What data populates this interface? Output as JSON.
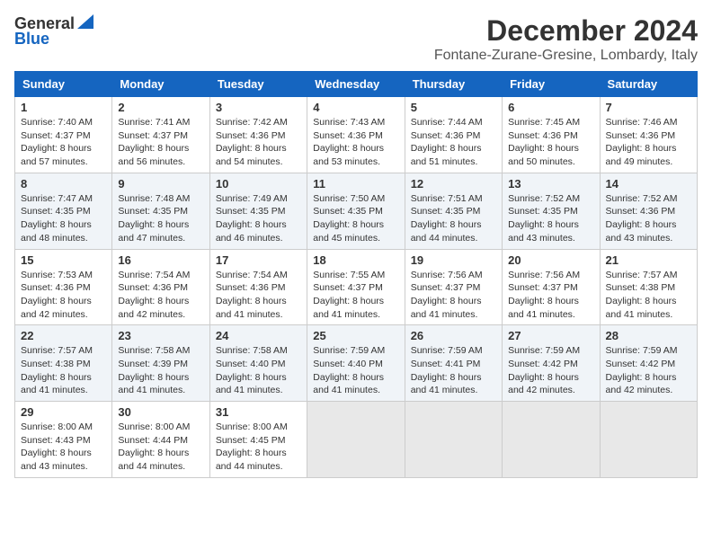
{
  "header": {
    "logo_general": "General",
    "logo_blue": "Blue",
    "month_title": "December 2024",
    "location": "Fontane-Zurane-Gresine, Lombardy, Italy"
  },
  "days_of_week": [
    "Sunday",
    "Monday",
    "Tuesday",
    "Wednesday",
    "Thursday",
    "Friday",
    "Saturday"
  ],
  "weeks": [
    [
      {
        "day": "1",
        "sunrise": "Sunrise: 7:40 AM",
        "sunset": "Sunset: 4:37 PM",
        "daylight": "Daylight: 8 hours and 57 minutes."
      },
      {
        "day": "2",
        "sunrise": "Sunrise: 7:41 AM",
        "sunset": "Sunset: 4:37 PM",
        "daylight": "Daylight: 8 hours and 56 minutes."
      },
      {
        "day": "3",
        "sunrise": "Sunrise: 7:42 AM",
        "sunset": "Sunset: 4:36 PM",
        "daylight": "Daylight: 8 hours and 54 minutes."
      },
      {
        "day": "4",
        "sunrise": "Sunrise: 7:43 AM",
        "sunset": "Sunset: 4:36 PM",
        "daylight": "Daylight: 8 hours and 53 minutes."
      },
      {
        "day": "5",
        "sunrise": "Sunrise: 7:44 AM",
        "sunset": "Sunset: 4:36 PM",
        "daylight": "Daylight: 8 hours and 51 minutes."
      },
      {
        "day": "6",
        "sunrise": "Sunrise: 7:45 AM",
        "sunset": "Sunset: 4:36 PM",
        "daylight": "Daylight: 8 hours and 50 minutes."
      },
      {
        "day": "7",
        "sunrise": "Sunrise: 7:46 AM",
        "sunset": "Sunset: 4:36 PM",
        "daylight": "Daylight: 8 hours and 49 minutes."
      }
    ],
    [
      {
        "day": "8",
        "sunrise": "Sunrise: 7:47 AM",
        "sunset": "Sunset: 4:35 PM",
        "daylight": "Daylight: 8 hours and 48 minutes."
      },
      {
        "day": "9",
        "sunrise": "Sunrise: 7:48 AM",
        "sunset": "Sunset: 4:35 PM",
        "daylight": "Daylight: 8 hours and 47 minutes."
      },
      {
        "day": "10",
        "sunrise": "Sunrise: 7:49 AM",
        "sunset": "Sunset: 4:35 PM",
        "daylight": "Daylight: 8 hours and 46 minutes."
      },
      {
        "day": "11",
        "sunrise": "Sunrise: 7:50 AM",
        "sunset": "Sunset: 4:35 PM",
        "daylight": "Daylight: 8 hours and 45 minutes."
      },
      {
        "day": "12",
        "sunrise": "Sunrise: 7:51 AM",
        "sunset": "Sunset: 4:35 PM",
        "daylight": "Daylight: 8 hours and 44 minutes."
      },
      {
        "day": "13",
        "sunrise": "Sunrise: 7:52 AM",
        "sunset": "Sunset: 4:35 PM",
        "daylight": "Daylight: 8 hours and 43 minutes."
      },
      {
        "day": "14",
        "sunrise": "Sunrise: 7:52 AM",
        "sunset": "Sunset: 4:36 PM",
        "daylight": "Daylight: 8 hours and 43 minutes."
      }
    ],
    [
      {
        "day": "15",
        "sunrise": "Sunrise: 7:53 AM",
        "sunset": "Sunset: 4:36 PM",
        "daylight": "Daylight: 8 hours and 42 minutes."
      },
      {
        "day": "16",
        "sunrise": "Sunrise: 7:54 AM",
        "sunset": "Sunset: 4:36 PM",
        "daylight": "Daylight: 8 hours and 42 minutes."
      },
      {
        "day": "17",
        "sunrise": "Sunrise: 7:54 AM",
        "sunset": "Sunset: 4:36 PM",
        "daylight": "Daylight: 8 hours and 41 minutes."
      },
      {
        "day": "18",
        "sunrise": "Sunrise: 7:55 AM",
        "sunset": "Sunset: 4:37 PM",
        "daylight": "Daylight: 8 hours and 41 minutes."
      },
      {
        "day": "19",
        "sunrise": "Sunrise: 7:56 AM",
        "sunset": "Sunset: 4:37 PM",
        "daylight": "Daylight: 8 hours and 41 minutes."
      },
      {
        "day": "20",
        "sunrise": "Sunrise: 7:56 AM",
        "sunset": "Sunset: 4:37 PM",
        "daylight": "Daylight: 8 hours and 41 minutes."
      },
      {
        "day": "21",
        "sunrise": "Sunrise: 7:57 AM",
        "sunset": "Sunset: 4:38 PM",
        "daylight": "Daylight: 8 hours and 41 minutes."
      }
    ],
    [
      {
        "day": "22",
        "sunrise": "Sunrise: 7:57 AM",
        "sunset": "Sunset: 4:38 PM",
        "daylight": "Daylight: 8 hours and 41 minutes."
      },
      {
        "day": "23",
        "sunrise": "Sunrise: 7:58 AM",
        "sunset": "Sunset: 4:39 PM",
        "daylight": "Daylight: 8 hours and 41 minutes."
      },
      {
        "day": "24",
        "sunrise": "Sunrise: 7:58 AM",
        "sunset": "Sunset: 4:40 PM",
        "daylight": "Daylight: 8 hours and 41 minutes."
      },
      {
        "day": "25",
        "sunrise": "Sunrise: 7:59 AM",
        "sunset": "Sunset: 4:40 PM",
        "daylight": "Daylight: 8 hours and 41 minutes."
      },
      {
        "day": "26",
        "sunrise": "Sunrise: 7:59 AM",
        "sunset": "Sunset: 4:41 PM",
        "daylight": "Daylight: 8 hours and 41 minutes."
      },
      {
        "day": "27",
        "sunrise": "Sunrise: 7:59 AM",
        "sunset": "Sunset: 4:42 PM",
        "daylight": "Daylight: 8 hours and 42 minutes."
      },
      {
        "day": "28",
        "sunrise": "Sunrise: 7:59 AM",
        "sunset": "Sunset: 4:42 PM",
        "daylight": "Daylight: 8 hours and 42 minutes."
      }
    ],
    [
      {
        "day": "29",
        "sunrise": "Sunrise: 8:00 AM",
        "sunset": "Sunset: 4:43 PM",
        "daylight": "Daylight: 8 hours and 43 minutes."
      },
      {
        "day": "30",
        "sunrise": "Sunrise: 8:00 AM",
        "sunset": "Sunset: 4:44 PM",
        "daylight": "Daylight: 8 hours and 44 minutes."
      },
      {
        "day": "31",
        "sunrise": "Sunrise: 8:00 AM",
        "sunset": "Sunset: 4:45 PM",
        "daylight": "Daylight: 8 hours and 44 minutes."
      },
      null,
      null,
      null,
      null
    ]
  ]
}
